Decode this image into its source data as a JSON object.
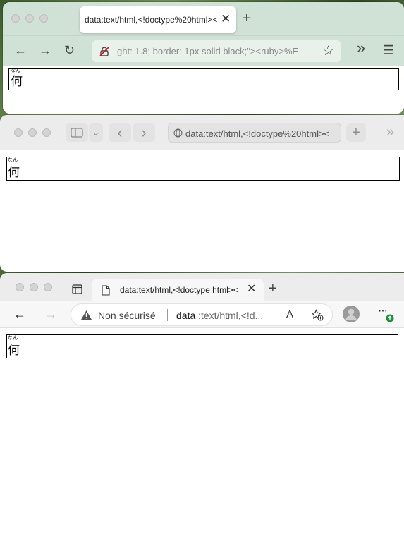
{
  "ruby": {
    "base": "何",
    "annotation": "なん"
  },
  "firefox": {
    "tab_title": "data:text/html,<!doctype%20html><",
    "tab_close": "✕",
    "new_tab": "+",
    "url_text": "ght: 1.8; border: 1px solid black;\"><ruby>%E",
    "back": "←",
    "forward": "→",
    "reload": "↻",
    "overflow": "»",
    "menu": "☰",
    "star": "☆"
  },
  "safari": {
    "url_text": "data:text/html,<!doctype%20html><",
    "back": "‹",
    "forward": "›",
    "new_tab": "+",
    "overflow": "»",
    "chevron": "⌄"
  },
  "edge": {
    "tab_title": "data:text/html,<!doctype html><",
    "tab_close": "✕",
    "new_tab": "+",
    "security_warning": "Non sécurisé",
    "url_scheme": "data",
    "url_rest": ":text/html,<!d...",
    "back": "←",
    "forward": "→",
    "more": "···",
    "read_aloud": "A",
    "colors": {
      "update_badge": "#1e8f3a"
    }
  }
}
